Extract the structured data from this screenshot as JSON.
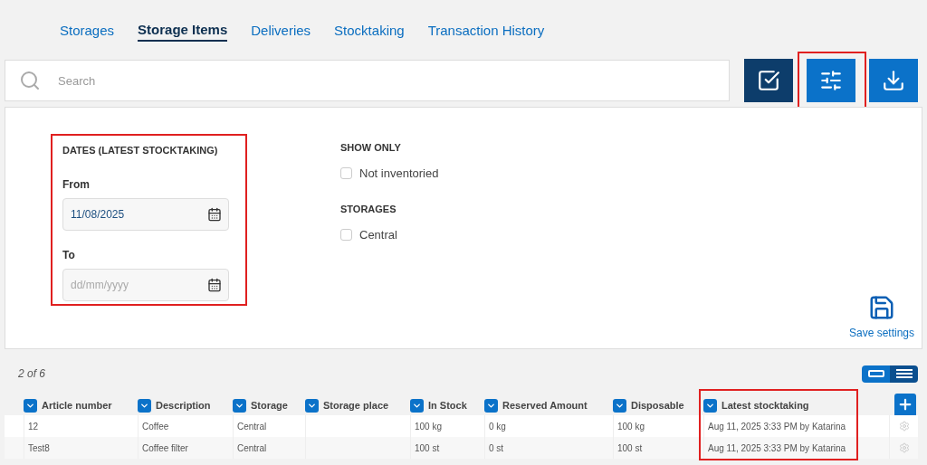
{
  "tabs": [
    {
      "label": "Storages",
      "selected": false
    },
    {
      "label": "Storage Items",
      "selected": true
    },
    {
      "label": "Deliveries",
      "selected": false
    },
    {
      "label": "Stocktaking",
      "selected": false
    },
    {
      "label": "Transaction History",
      "selected": false
    }
  ],
  "search": {
    "placeholder": "Search"
  },
  "toolbar": [
    {
      "kind": "select",
      "dark": true,
      "highlighted": false
    },
    {
      "kind": "filter",
      "dark": false,
      "highlighted": true
    },
    {
      "kind": "download",
      "dark": false,
      "highlighted": false
    }
  ],
  "filters": {
    "dates": {
      "title": "DATES (LATEST STOCKTAKING)",
      "highlighted": true,
      "from_label": "From",
      "from_value": "11/08/2025",
      "to_label": "To",
      "to_placeholder": "dd/mm/yyyy"
    },
    "show_only": {
      "title": "SHOW ONLY",
      "options": [
        {
          "label": "Not inventoried",
          "checked": false
        }
      ]
    },
    "storages": {
      "title": "STORAGES",
      "options": [
        {
          "label": "Central",
          "checked": false
        }
      ]
    },
    "save": "Save settings"
  },
  "count": "2 of 6",
  "view_toggle": [
    {
      "kind": "card",
      "selected": false
    },
    {
      "kind": "list",
      "selected": true
    }
  ],
  "table": {
    "columns": [
      {
        "label": "Article number",
        "highlighted": false
      },
      {
        "label": "Description",
        "highlighted": false
      },
      {
        "label": "Storage",
        "highlighted": false
      },
      {
        "label": "Storage place",
        "highlighted": false
      },
      {
        "label": "In Stock",
        "highlighted": false
      },
      {
        "label": "Reserved Amount",
        "highlighted": false
      },
      {
        "label": "Disposable",
        "highlighted": false
      },
      {
        "label": "Latest stocktaking",
        "highlighted": true
      }
    ],
    "rows": [
      [
        "12",
        "Coffee",
        "Central",
        "",
        "100 kg",
        "0 kg",
        "100 kg",
        "Aug 11, 2025 3:33 PM by Katarina"
      ],
      [
        "Test8",
        "Coffee filter",
        "Central",
        "",
        "100 st",
        "0 st",
        "100 st",
        "Aug 11, 2025 3:33 PM by Katarina"
      ]
    ]
  }
}
